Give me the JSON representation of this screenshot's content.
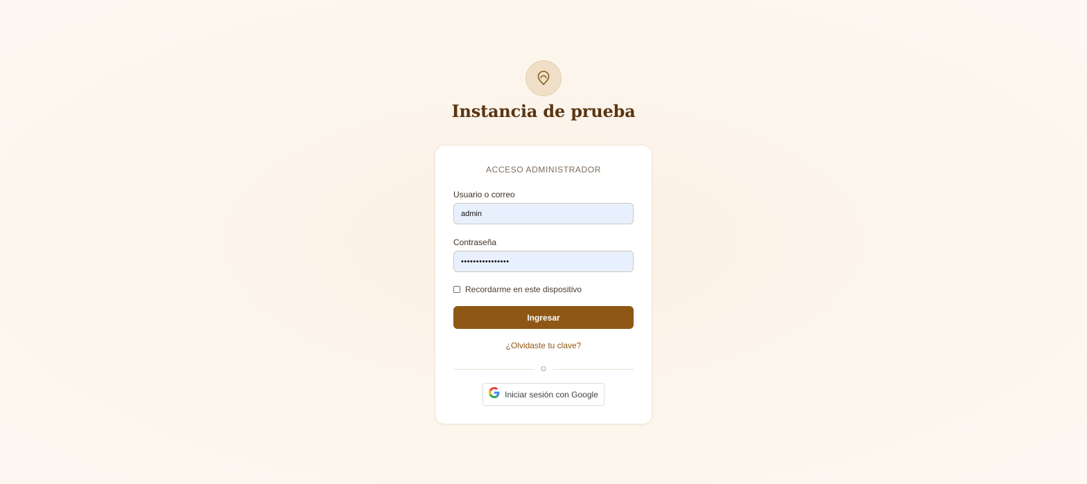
{
  "branding": {
    "logo_icon": "map-pin-icon",
    "title": "Instancia de prueba"
  },
  "login": {
    "heading": "ACCESO ADMINISTRADOR",
    "username_label": "Usuario o correo",
    "username_value": "admin",
    "password_label": "Contraseña",
    "password_value": "••••••••••••••••",
    "remember_label": "Recordarme en este dispositivo",
    "remember_checked": false,
    "submit_label": "Ingresar",
    "forgot_label": "¿Olvidaste tu clave?",
    "divider_text": "O",
    "google_label": "Iniciar sesión con Google",
    "google_icon": "google-g-icon"
  },
  "colors": {
    "accent": "#8f5716",
    "title": "#5a3512",
    "logo_bg": "#efdfc6",
    "input_bg": "#e8f0fe"
  }
}
